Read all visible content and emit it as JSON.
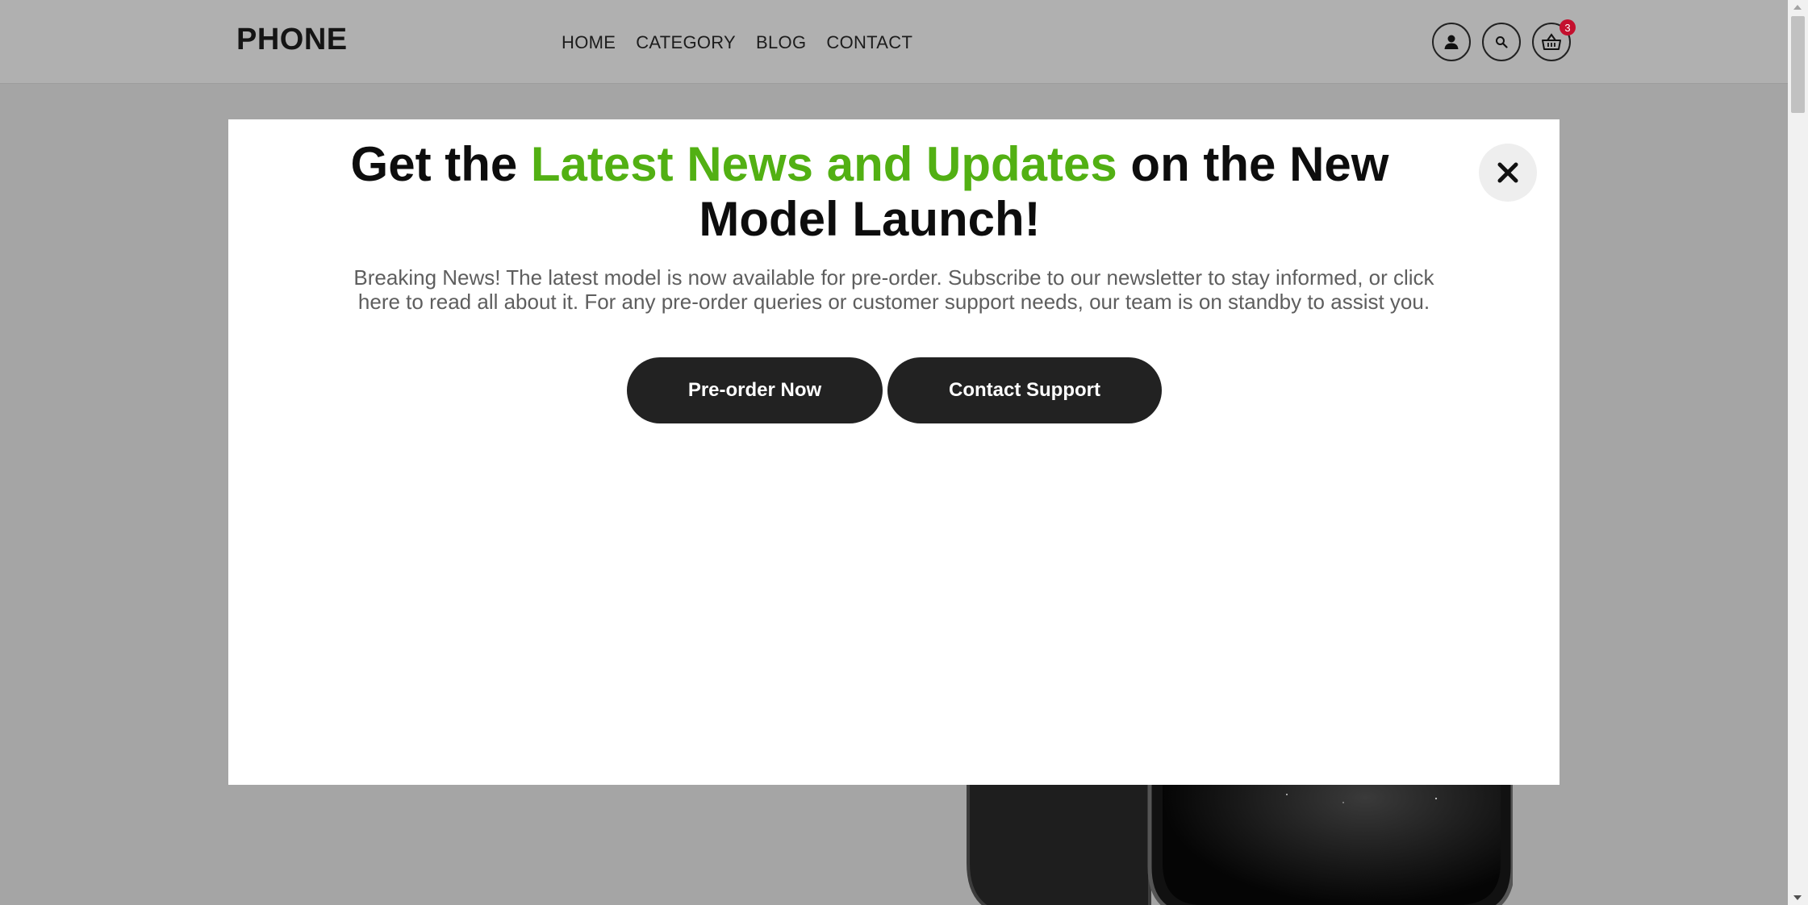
{
  "header": {
    "logo": "PHONE",
    "nav": [
      "HOME",
      "CATEGORY",
      "BLOG",
      "CONTACT"
    ],
    "icons": [
      "user-icon",
      "search-icon",
      "basket-icon"
    ],
    "cart_count": "3"
  },
  "modal": {
    "title_before": "Get the ",
    "title_accent": "Latest News and Updates",
    "title_after": " on the New Model Launch!",
    "body": "Breaking News! The latest model is now available for pre-order. Subscribe to our newsletter to stay informed, or click here to read all about it. For any pre-order queries or customer support needs, our team is on standby to assist you.",
    "primary_button": "Pre-order Now",
    "secondary_button": "Contact Support",
    "close_icon": "close-icon"
  },
  "colors": {
    "accent": "#52b013",
    "button": "#222222",
    "badge": "#c4102e",
    "overlay": "#a5a5a5"
  }
}
